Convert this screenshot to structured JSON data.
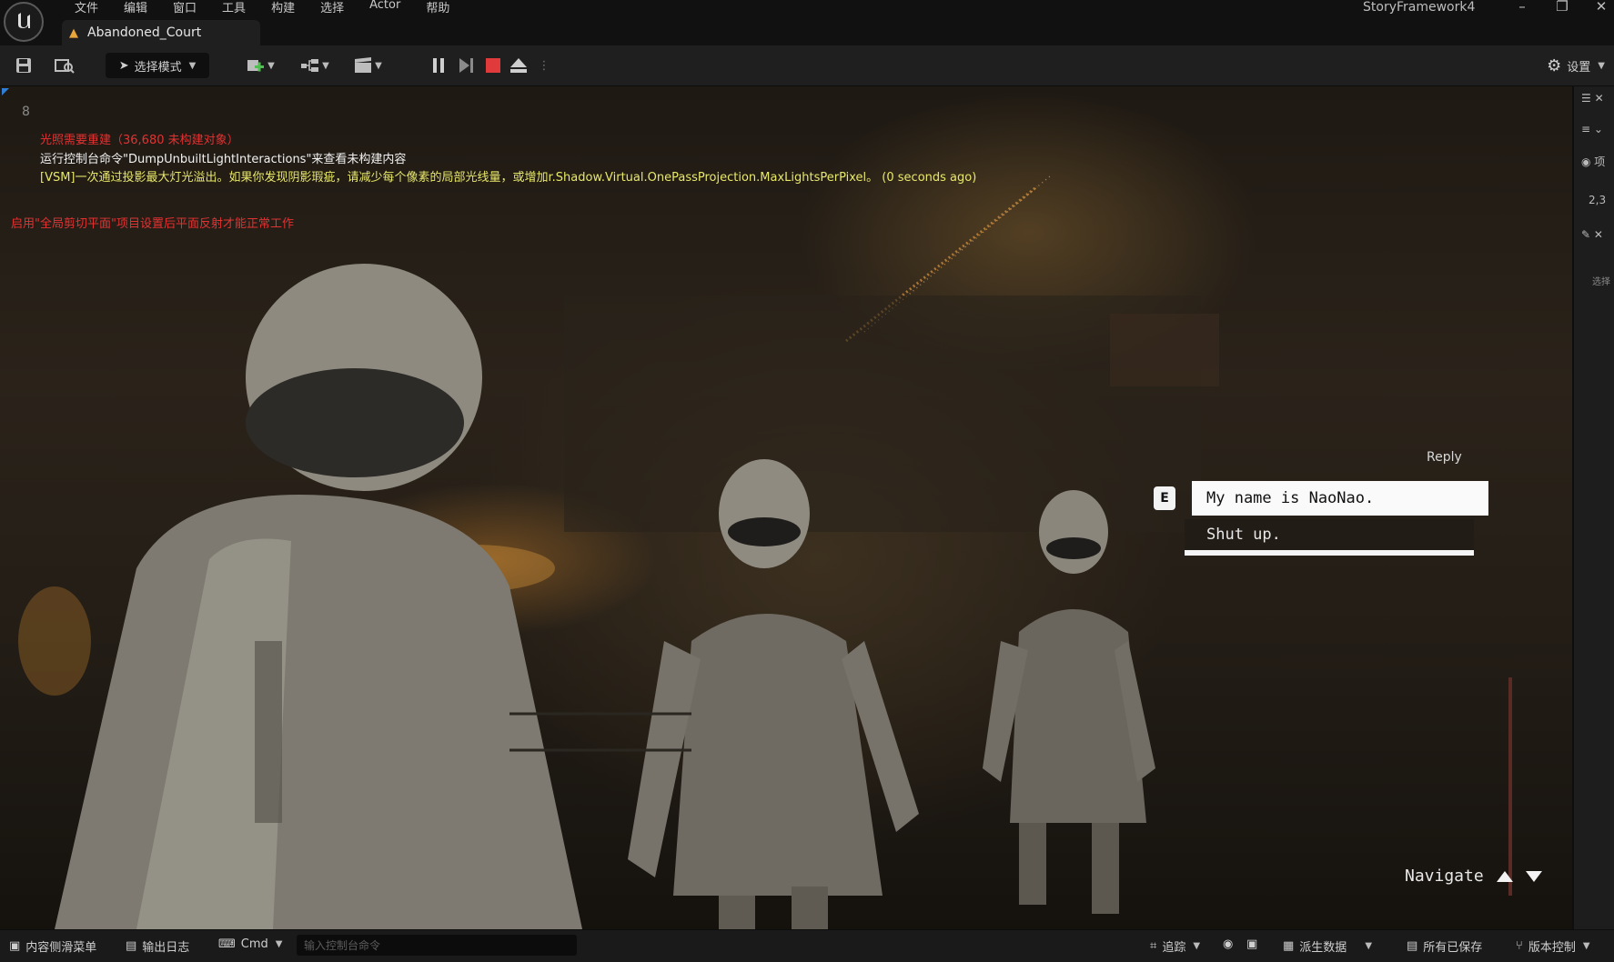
{
  "titlebar": {
    "menu": [
      "文件",
      "编辑",
      "窗口",
      "工具",
      "构建",
      "选择",
      "Actor",
      "帮助"
    ],
    "tab_label": "Abandoned_Court",
    "app_name": "StoryFramework4"
  },
  "toolbar": {
    "mode_label": "选择模式",
    "settings_label": "设置"
  },
  "viewport": {
    "fps": "8",
    "messages": {
      "red1": "光照需要重建（36,680 未构建对象）",
      "white": "运行控制台命令\"DumpUnbuiltLightInteractions\"来查看未构建内容",
      "yellow": "[VSM]一次通过投影最大灯光溢出。如果你发现阴影瑕疵，请减少每个像素的局部光线量，或增加r.Shadow.Virtual.OnePassProjection.MaxLightsPerPixel。 (0 seconds ago)",
      "red2": "启用\"全局剪切平面\"项目设置后平面反射才能正常工作"
    },
    "dialog": {
      "reply_label": "Reply",
      "key_hint": "E",
      "options": [
        "My name is NaoNao.",
        "Shut up."
      ],
      "navigate_label": "Navigate"
    }
  },
  "rightpanel": {
    "items": [
      "项",
      "2,3",
      "选择"
    ]
  },
  "statusbar": {
    "content_drawer": "内容侧滑菜单",
    "output_log": "输出日志",
    "cmd_label": "Cmd",
    "cmd_placeholder": "输入控制台命令",
    "trace": "追踪",
    "derived_data": "派生数据",
    "all_saved": "所有已保存",
    "source_control": "版本控制"
  },
  "colors": {
    "error_text": "#e33232",
    "warning_text": "#e8e86a",
    "stop_button": "#e03a3a",
    "viewport_marker": "#2f7fd8"
  }
}
